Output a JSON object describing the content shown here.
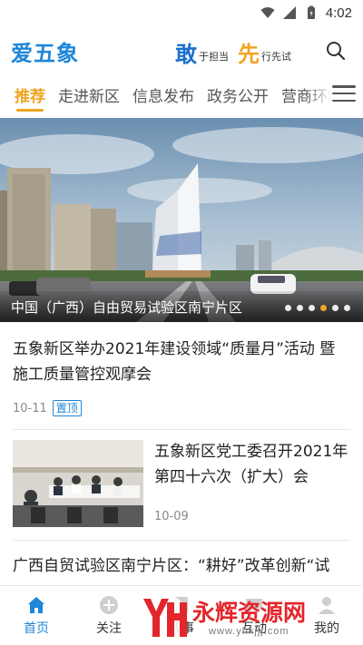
{
  "status_bar": {
    "time": "4:02"
  },
  "header": {
    "logo": "爱五象",
    "slogan": {
      "char1": "敢",
      "text1": "于担当",
      "char2": "先",
      "text2": "行先试"
    }
  },
  "tabs": [
    "推荐",
    "走进新区",
    "信息发布",
    "政务公开",
    "营商环境"
  ],
  "banner": {
    "caption": "中国（广西）自由贸易试验区南宁片区",
    "dots": 6,
    "active_dot": 3
  },
  "news": [
    {
      "title": "五象新区举办2021年建设领域“质量月”活动 暨施工质量管控观摩会",
      "date": "10-11",
      "badge": "置顶"
    },
    {
      "title": "五象新区党工委召开2021年第四十六次（扩大）会",
      "date": "10-09"
    },
    {
      "title": "广西自贸试验区南宁片区：“耕好”改革创新“试"
    }
  ],
  "bottom_nav": [
    {
      "label": "首页",
      "icon": "home-icon",
      "active": true
    },
    {
      "label": "关注",
      "icon": "plus-circle-icon"
    },
    {
      "label": "政事",
      "icon": "document-icon"
    },
    {
      "label": "互动",
      "icon": "chat-icon"
    },
    {
      "label": "我的",
      "icon": "user-icon"
    }
  ],
  "watermark": {
    "text": "永辉资源网",
    "url": "www.yhkjjj.com"
  },
  "colors": {
    "brand_blue": "#1f86d8",
    "accent_gold": "#f1a322",
    "watermark_red": "#e3262b"
  }
}
